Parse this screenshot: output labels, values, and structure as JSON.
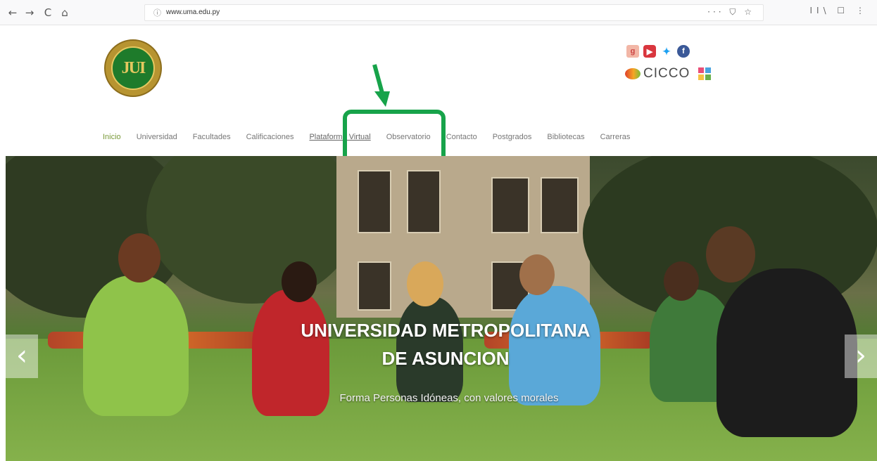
{
  "browser": {
    "back": "←",
    "forward": "→",
    "reload": "C",
    "home": "⌂",
    "url": "www.uma.edu.py",
    "page_actions": "··· ⛉ ☆",
    "tools": "II\\ ☐ ⋮"
  },
  "header": {
    "logo_text": "JUI",
    "social_icons": [
      "google-plus-icon",
      "youtube-icon",
      "twitter-icon",
      "facebook-icon"
    ],
    "cicco_label": "CICCO"
  },
  "menu": {
    "items": [
      "Inicio",
      "Universidad",
      "Facultades",
      "Calificaciones",
      "Plataforma Virtual",
      "Observatorio",
      "Contacto",
      "Postgrados",
      "Bibliotecas",
      "Carreras"
    ]
  },
  "annotation": {
    "color": "#17a34a"
  },
  "hero": {
    "title_line1": "UNIVERSIDAD METROPOLITANA",
    "title_line2": "DE ASUNCION",
    "subtitle": "Forma Personas Idóneas, con valores morales",
    "prev": "‹",
    "next": "›"
  }
}
